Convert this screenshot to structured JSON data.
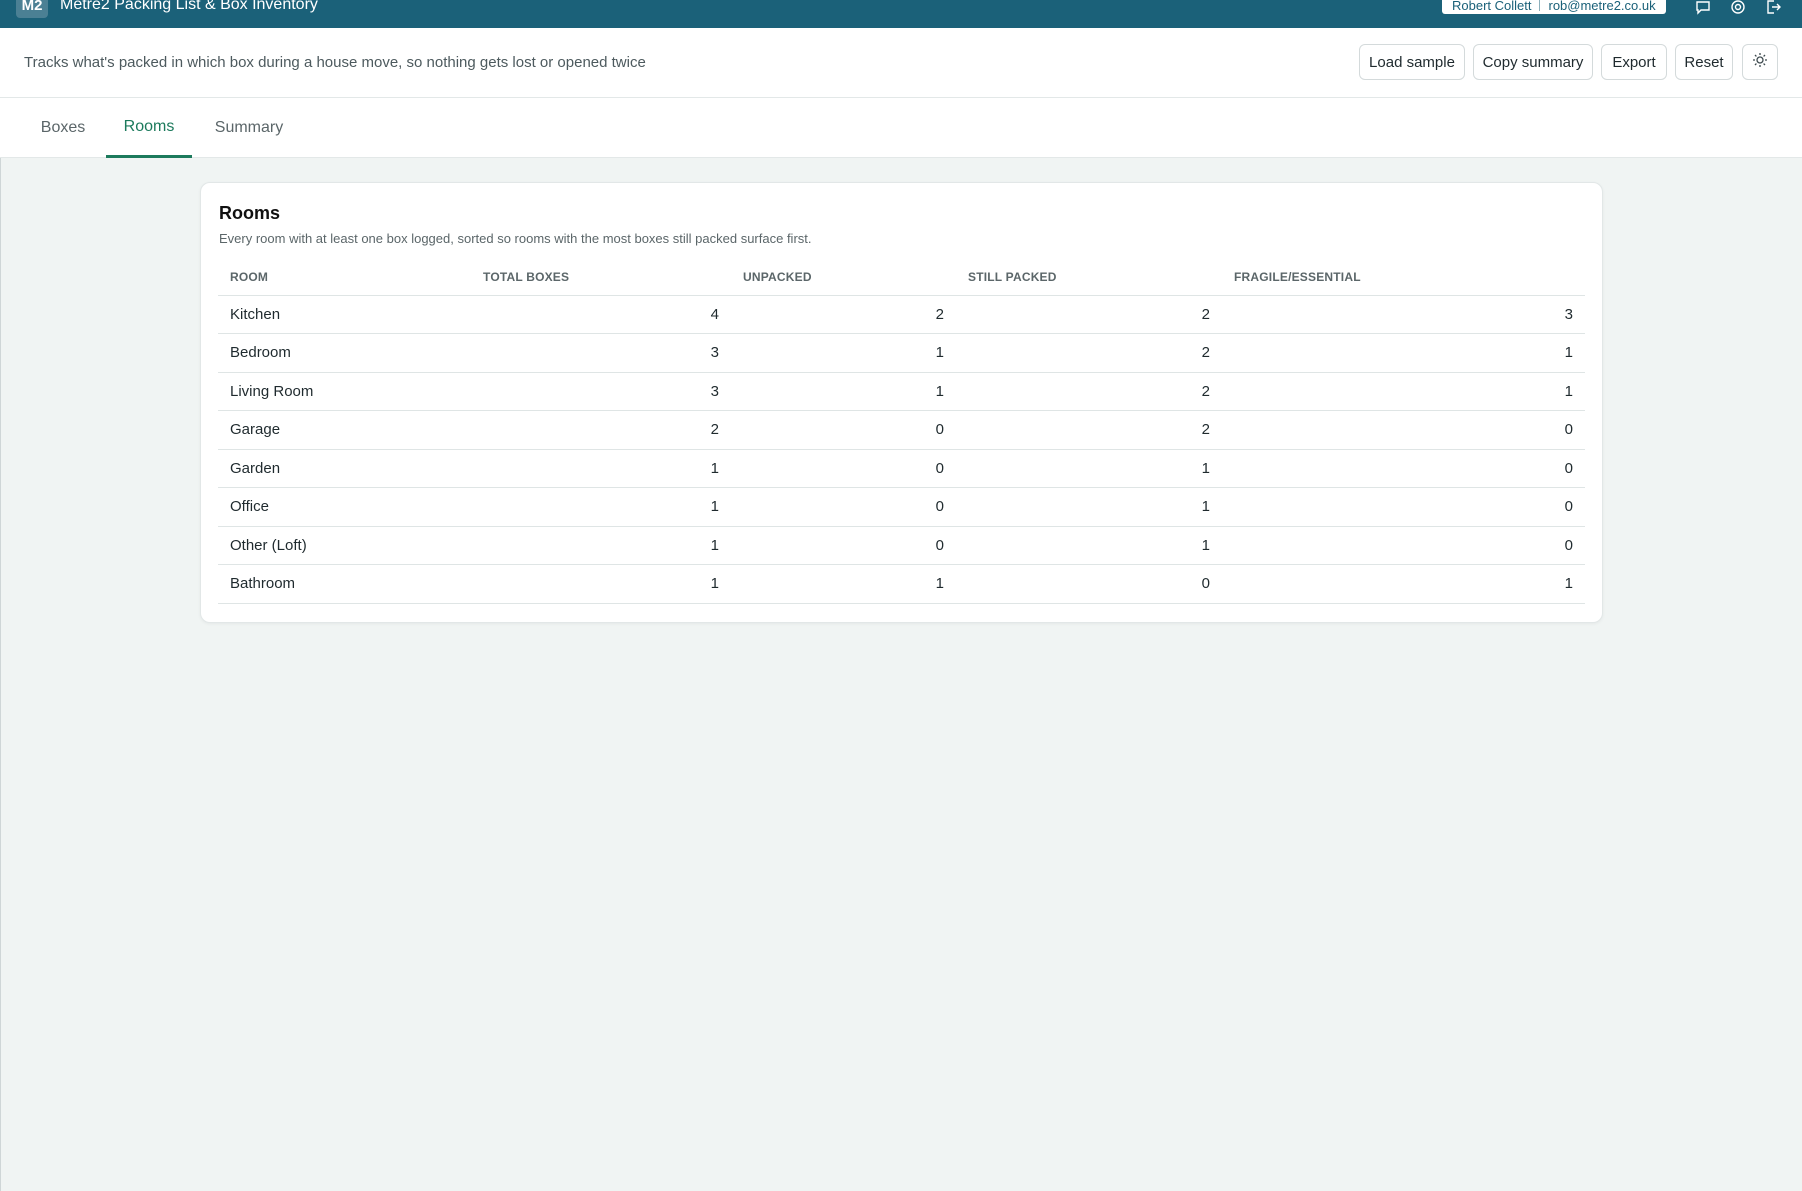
{
  "app": {
    "badge": "M2",
    "title": "Metre2 Packing List & Box Inventory",
    "user_name": "Robert Collett",
    "user_email": "rob@metre2.co.uk"
  },
  "header": {
    "tagline": "Tracks what's packed in which box during a house move, so nothing gets lost or opened twice",
    "buttons": {
      "load_sample": "Load sample",
      "copy_summary": "Copy summary",
      "export": "Export",
      "reset": "Reset"
    }
  },
  "tabs": [
    {
      "label": "Boxes",
      "active": false
    },
    {
      "label": "Rooms",
      "active": true
    },
    {
      "label": "Summary",
      "active": false
    }
  ],
  "rooms_card": {
    "title": "Rooms",
    "description": "Every room with at least one box logged, sorted so rooms with the most boxes still packed surface first.",
    "columns": [
      "Room",
      "Total boxes",
      "Unpacked",
      "Still packed",
      "Fragile/Essential"
    ],
    "rows": [
      [
        "Kitchen",
        "4",
        "2",
        "2",
        "3"
      ],
      [
        "Bedroom",
        "3",
        "1",
        "2",
        "1"
      ],
      [
        "Living Room",
        "3",
        "1",
        "2",
        "1"
      ],
      [
        "Garage",
        "2",
        "0",
        "2",
        "0"
      ],
      [
        "Garden",
        "1",
        "0",
        "1",
        "0"
      ],
      [
        "Office",
        "1",
        "0",
        "1",
        "0"
      ],
      [
        "Other (Loft)",
        "1",
        "0",
        "1",
        "0"
      ],
      [
        "Bathroom",
        "1",
        "1",
        "0",
        "1"
      ]
    ]
  },
  "colors": {
    "topbar": "#1b6179",
    "accent": "#1c7a5c",
    "background": "#f0f4f3"
  },
  "icons": [
    "chat-icon",
    "settings-icon",
    "logout-icon",
    "theme-toggle-icon"
  ]
}
